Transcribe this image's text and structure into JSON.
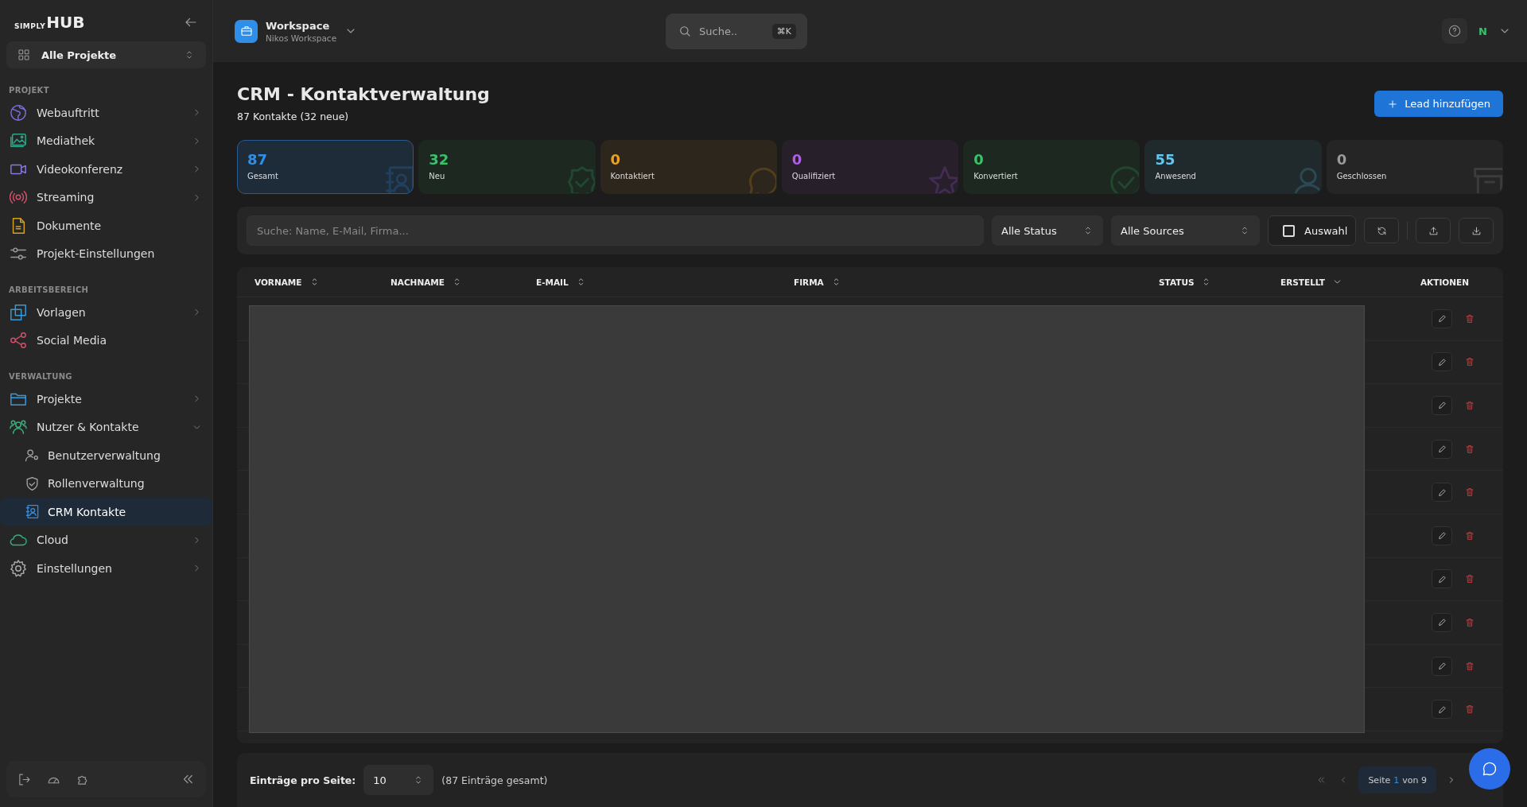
{
  "sidebar": {
    "logo": {
      "small": "SIMPLY",
      "big": "HUB"
    },
    "project_select": "Alle Projekte",
    "sections": [
      {
        "title": "PROJEKT",
        "items": [
          {
            "label": "Webauftritt",
            "selected": false,
            "expanded": false
          },
          {
            "label": "Mediathek",
            "selected": false,
            "expanded": false
          },
          {
            "label": "Videokonferenz",
            "selected": false,
            "expanded": false
          },
          {
            "label": "Streaming",
            "selected": false,
            "expanded": false
          },
          {
            "label": "Dokumente",
            "selected": false
          },
          {
            "label": "Projekt-Einstellungen",
            "selected": false
          }
        ]
      },
      {
        "title": "ARBEITSBEREICH",
        "items": [
          {
            "label": "Vorlagen",
            "selected": false,
            "expanded": false
          },
          {
            "label": "Social Media",
            "selected": false
          }
        ]
      },
      {
        "title": "VERWALTUNG",
        "items": [
          {
            "label": "Projekte",
            "selected": false,
            "expanded": false
          },
          {
            "label": "Nutzer & Kontakte",
            "selected": false,
            "expanded": true,
            "children": [
              {
                "label": "Benutzerverwaltung",
                "selected": false
              },
              {
                "label": "Rollenverwaltung",
                "selected": false
              },
              {
                "label": "CRM Kontakte",
                "selected": true
              }
            ]
          },
          {
            "label": "Cloud",
            "selected": false,
            "expanded": false
          },
          {
            "label": "Einstellungen",
            "selected": false,
            "expanded": false
          }
        ]
      }
    ]
  },
  "topbar": {
    "workspace": {
      "title": "Workspace",
      "subtitle": "Nikos Workspace"
    },
    "search": {
      "placeholder": "Suche..",
      "shortcut": "⌘K"
    },
    "avatar": "N"
  },
  "page": {
    "title": "CRM - Kontaktverwaltung",
    "subtitle": "87 Kontakte (32 neue)",
    "add_button": "Lead hinzufügen"
  },
  "stats": [
    {
      "value": "87",
      "label": "Gesamt",
      "color": "#2f8fe8",
      "selected": true
    },
    {
      "value": "32",
      "label": "Neu",
      "color": "#35c46a",
      "selected": false
    },
    {
      "value": "0",
      "label": "Kontaktiert",
      "color": "#f0a020",
      "selected": false
    },
    {
      "value": "0",
      "label": "Qualifiziert",
      "color": "#b05ee8",
      "selected": false
    },
    {
      "value": "0",
      "label": "Konvertiert",
      "color": "#35c46a",
      "selected": false
    },
    {
      "value": "55",
      "label": "Anwesend",
      "color": "#5ec8f0",
      "selected": false
    },
    {
      "value": "0",
      "label": "Geschlossen",
      "color": "#9a9a9a",
      "selected": false
    }
  ],
  "filters": {
    "search": {
      "placeholder": "Suche: Name, E-Mail, Firma..."
    },
    "status": "Alle Status",
    "sources": "Alle Sources",
    "selection": {
      "label": "Auswahl",
      "checked": false
    }
  },
  "table": {
    "columns": [
      {
        "label": "VORNAME"
      },
      {
        "label": "NACHNAME"
      },
      {
        "label": "E-MAIL"
      },
      {
        "label": "FIRMA"
      },
      {
        "label": "STATUS"
      },
      {
        "label": "ERSTELLT"
      },
      {
        "label": "AKTIONEN"
      }
    ],
    "rows": [
      {
        "kind": "blurred"
      },
      {
        "kind": "blurred"
      },
      {
        "kind": "blurred"
      },
      {
        "kind": "blurred"
      },
      {
        "kind": "blurred"
      },
      {
        "kind": "blurred"
      },
      {
        "kind": "blurred"
      },
      {
        "kind": "blurred"
      },
      {
        "kind": "blurred"
      },
      {
        "kind": "blurred"
      }
    ]
  },
  "footer": {
    "per_page_label": "Einträge pro Seite:",
    "per_page": "10",
    "total": "(87 Einträge gesamt)",
    "page_prefix": "Seite",
    "page_current": "1",
    "page_suffix": "von 9"
  }
}
